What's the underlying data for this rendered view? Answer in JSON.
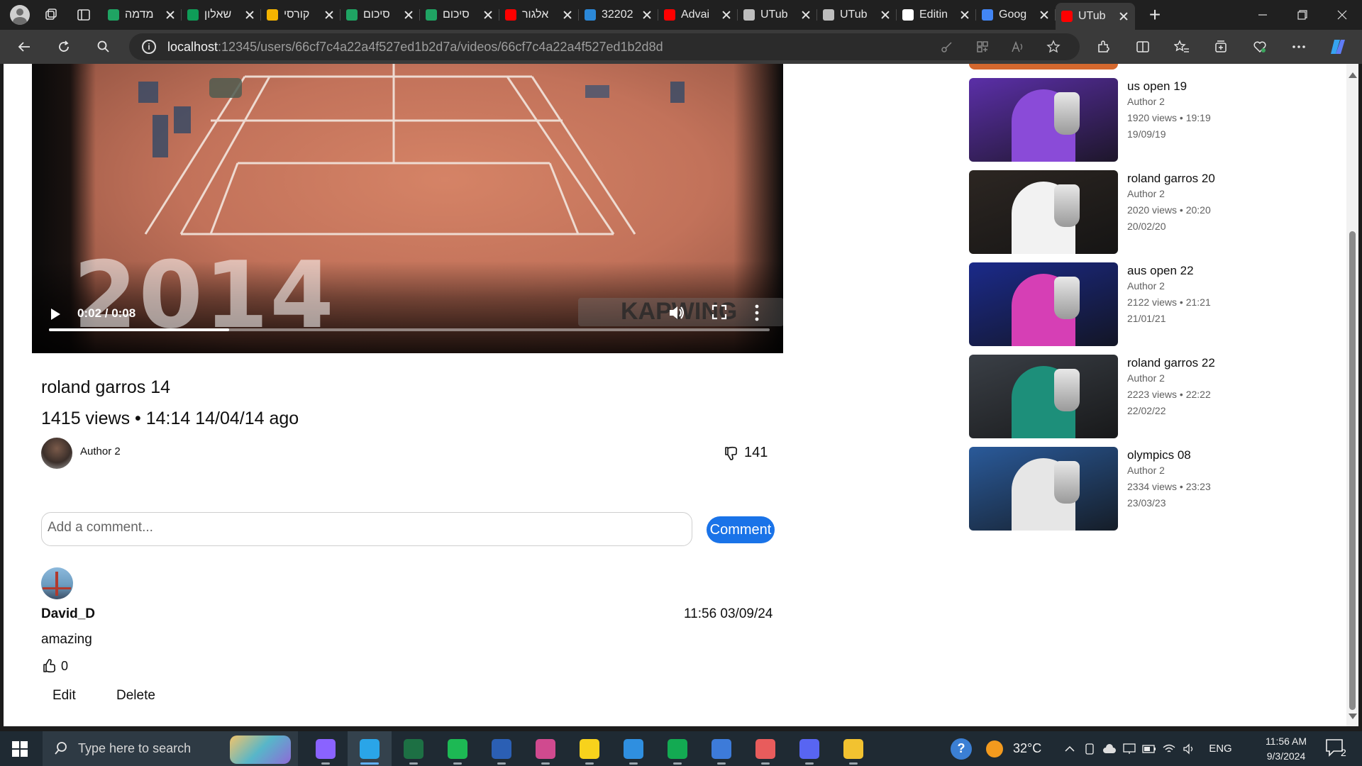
{
  "browser": {
    "tabs": [
      {
        "label": "מדמה",
        "icon": "google-drive-icon",
        "color": "#1fa463"
      },
      {
        "label": "שאלון",
        "icon": "google-sheets-icon",
        "color": "#0f9d58"
      },
      {
        "label": "קורסי",
        "icon": "google-drive-icon",
        "color": "#f4b400"
      },
      {
        "label": "סיכום",
        "icon": "google-drive-icon",
        "color": "#1fa463"
      },
      {
        "label": "סיכום",
        "icon": "google-drive-icon",
        "color": "#1fa463"
      },
      {
        "label": "אלגור",
        "icon": "youtube-icon",
        "color": "#ff0000"
      },
      {
        "label": "32202",
        "icon": "azure-icon",
        "color": "#2b88d8"
      },
      {
        "label": "Advai",
        "icon": "youtube-icon",
        "color": "#ff0000"
      },
      {
        "label": "UTub",
        "icon": "chatgpt-icon",
        "color": "#bdbdbd"
      },
      {
        "label": "UTub",
        "icon": "chatgpt-icon",
        "color": "#bdbdbd"
      },
      {
        "label": "Editin",
        "icon": "github-icon",
        "color": "#ffffff"
      },
      {
        "label": "Goog",
        "icon": "google-translate-icon",
        "color": "#4285f4"
      },
      {
        "label": "UTub",
        "icon": "youtube-icon",
        "color": "#ff0000",
        "active": true
      }
    ],
    "url_host": "localhost",
    "url_path": ":12345/users/66cf7c4a22a4f527ed1b2d7a/videos/66cf7c4a22a4f527ed1b2d8d"
  },
  "video": {
    "year_overlay": "2014",
    "watermark": "KAPWING",
    "time": "0:02 / 0:08",
    "progress_fraction": 0.25,
    "title": "roland garros 14",
    "stats": "1415 views • 14:14 14/04/14 ago",
    "author": "Author 2",
    "dislikes": "141"
  },
  "comment_form": {
    "placeholder": "Add a comment...",
    "button_label": "Comment"
  },
  "comments": [
    {
      "user": "David_D",
      "time": "11:56 03/09/24",
      "text": "amazing",
      "likes": "0",
      "edit_label": "Edit",
      "delete_label": "Delete"
    }
  ],
  "related": [
    {
      "title": "us open 19",
      "author": "Author 2",
      "views_line": "1920 views • 19:19",
      "date": "19/09/19",
      "bg": "#5b2fa8",
      "fig": "#8a4bd8"
    },
    {
      "title": "roland garros 20",
      "author": "Author 2",
      "views_line": "2020 views • 20:20",
      "date": "20/02/20",
      "bg": "#2c2622",
      "fig": "#f2f2f2"
    },
    {
      "title": "aus open 22",
      "author": "Author 2",
      "views_line": "2122 views • 21:21",
      "date": "21/01/21",
      "bg": "#1b2a8a",
      "fig": "#d63fb5"
    },
    {
      "title": "roland garros 22",
      "author": "Author 2",
      "views_line": "2223 views • 22:22",
      "date": "22/02/22",
      "bg": "#3a3f46",
      "fig": "#1d8f7a"
    },
    {
      "title": "olympics 08",
      "author": "Author 2",
      "views_line": "2334 views • 23:23",
      "date": "23/03/23",
      "bg": "#2a5a9a",
      "fig": "#e6e6e6"
    }
  ],
  "taskbar": {
    "search_placeholder": "Type here to search",
    "apps": [
      {
        "name": "copilot-icon",
        "color": "#8a63ff"
      },
      {
        "name": "edge-icon",
        "color": "#2aa5e8",
        "active": true
      },
      {
        "name": "excel-icon",
        "color": "#1d7044"
      },
      {
        "name": "spotify-icon",
        "color": "#1db954"
      },
      {
        "name": "word-icon",
        "color": "#2b5fb4"
      },
      {
        "name": "snipping-tool-icon",
        "color": "#d04a8f"
      },
      {
        "name": "sticky-notes-icon",
        "color": "#f7d21c"
      },
      {
        "name": "vscode-icon",
        "color": "#2f8fe0"
      },
      {
        "name": "mongodb-compass-icon",
        "color": "#13aa52"
      },
      {
        "name": "app-store-icon",
        "color": "#3d7bd9"
      },
      {
        "name": "paint-icon",
        "color": "#e85c5c"
      },
      {
        "name": "discord-icon",
        "color": "#5865f2"
      },
      {
        "name": "file-explorer-icon",
        "color": "#f2c230"
      }
    ],
    "temperature": "32°C",
    "language": "ENG",
    "clock_time": "11:56 AM",
    "clock_date": "9/3/2024",
    "notifications": "2"
  }
}
